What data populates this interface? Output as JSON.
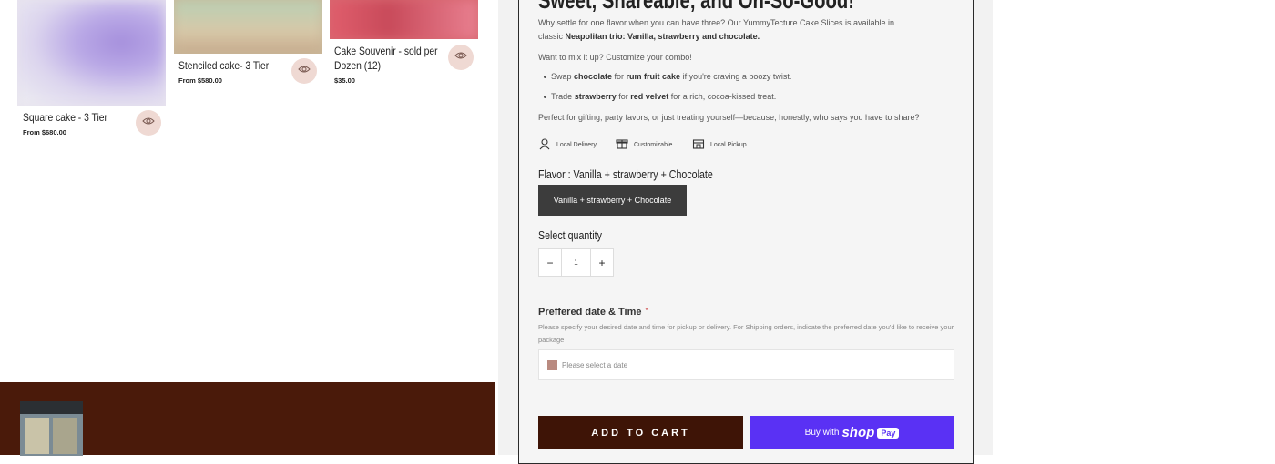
{
  "products": [
    {
      "title": "Square cake - 3 Tier",
      "price": "From $680.00"
    },
    {
      "title": "Stenciled cake- 3 Tier",
      "price": "From $580.00"
    },
    {
      "title_line1": "Cake Souvenir - sold per",
      "title_line2": "Dozen (12)",
      "price": "$35.00"
    }
  ],
  "product": {
    "heading": "Sweet, Shareable, and Oh-So-Good!",
    "intro": "Why settle for one flavor when you can have three? Our YummyTecture Cake Slices is available in classic",
    "intro_bold": "Neapolitan trio: Vanilla, strawberry and chocolate.",
    "customize": "Want to mix it up? Customize your combo!",
    "bullet1": {
      "pre": "Swap ",
      "b1": "chocolate",
      "mid": " for ",
      "b2": "rum fruit cake",
      "post": " if you're craving a boozy twist."
    },
    "bullet2": {
      "pre": "Trade ",
      "b1": "strawberry",
      "mid": " for ",
      "b2": "red velvet",
      "post": " for a rich, cocoa-kissed treat."
    },
    "gifting": "Perfect for gifting, party favors, or just treating yourself—because, honestly, who says you have to share?",
    "features": [
      "Local Delivery",
      "Customizable",
      "Local Pickup"
    ],
    "flavor_label": "Flavor : Vanilla + strawberry + Chocolate",
    "flavor_option": "Vanilla + strawberry + Chocolate",
    "quantity_label": "Select quantity",
    "quantity": "1",
    "qty_minus": "−",
    "qty_plus": "+",
    "date_title": "Preffered date & Time",
    "date_required": "*",
    "date_help": "Please specify your desired date and time for pickup or delivery. For Shipping orders, indicate the preferred date you'd like to receive your package",
    "date_placeholder": "Please select a date",
    "add_to_cart": "ADD TO CART",
    "buy_with": "Buy with",
    "shop_word": "shop",
    "pay_word": "Pay"
  },
  "colors": {
    "accent": "#3e1406",
    "shop": "#5a31f4",
    "footer": "#4a1a0a"
  }
}
